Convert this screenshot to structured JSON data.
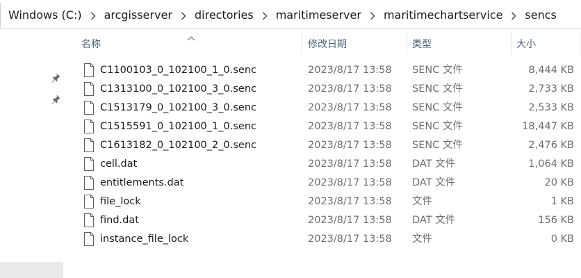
{
  "breadcrumb": [
    "Windows (C:)",
    "arcgisserver",
    "directories",
    "maritimeserver",
    "maritimechartservice",
    "sencs"
  ],
  "columns": {
    "name": "名称",
    "date": "修改日期",
    "type": "类型",
    "size": "大小"
  },
  "sort": {
    "column": "name",
    "direction": "ascending"
  },
  "files": [
    {
      "name": "C1100103_0_102100_1_0.senc",
      "date": "2023/8/17 13:58",
      "type": "SENC 文件",
      "size": "8,444 KB"
    },
    {
      "name": "C1313100_0_102100_3_0.senc",
      "date": "2023/8/17 13:58",
      "type": "SENC 文件",
      "size": "2,733 KB"
    },
    {
      "name": "C1513179_0_102100_3_0.senc",
      "date": "2023/8/17 13:58",
      "type": "SENC 文件",
      "size": "2,533 KB"
    },
    {
      "name": "C1515591_0_102100_1_0.senc",
      "date": "2023/8/17 13:58",
      "type": "SENC 文件",
      "size": "18,447 KB"
    },
    {
      "name": "C1613182_0_102100_2_0.senc",
      "date": "2023/8/17 13:58",
      "type": "SENC 文件",
      "size": "2,476 KB"
    },
    {
      "name": "cell.dat",
      "date": "2023/8/17 13:58",
      "type": "DAT 文件",
      "size": "1,064 KB"
    },
    {
      "name": "entitlements.dat",
      "date": "2023/8/17 13:58",
      "type": "DAT 文件",
      "size": "20 KB"
    },
    {
      "name": "file_lock",
      "date": "2023/8/17 13:58",
      "type": "文件",
      "size": "1 KB"
    },
    {
      "name": "find.dat",
      "date": "2023/8/17 13:58",
      "type": "DAT 文件",
      "size": "156 KB"
    },
    {
      "name": "instance_file_lock",
      "date": "2023/8/17 13:58",
      "type": "文件",
      "size": "0 KB"
    }
  ],
  "icons": {
    "breadcrumb_separator": "chevron-right-icon",
    "file": "file-icon",
    "pin": "pin-icon",
    "sort": "sort-ascending-icon"
  },
  "colors": {
    "header_text": "#4c607a",
    "secondary_text": "#6d6d6d",
    "primary_text": "#1a1a1a",
    "left_pane_footer": "#e9e9e9"
  }
}
